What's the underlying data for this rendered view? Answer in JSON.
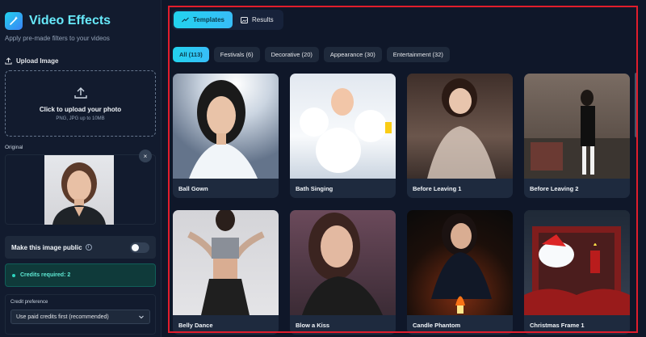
{
  "brand": {
    "title": "Video Effects",
    "subtitle": "Apply pre-made filters to your videos"
  },
  "upload": {
    "label": "Upload Image",
    "drop_title": "Click to upload your photo",
    "drop_sub": "PNG, JPG up to 10MB"
  },
  "original": {
    "label": "Original",
    "close_glyph": "×"
  },
  "public_toggle": {
    "label": "Make this image public",
    "on": false
  },
  "credits": {
    "text": "Credits required: 2"
  },
  "preference": {
    "label": "Credit preference",
    "selected": "Use paid credits first (recommended)"
  },
  "tabs": [
    {
      "label": "Templates",
      "active": true,
      "icon": "trend-icon"
    },
    {
      "label": "Results",
      "active": false,
      "icon": "image-icon"
    }
  ],
  "filters": [
    {
      "label": "All (113)",
      "active": true
    },
    {
      "label": "Festivals (6)",
      "active": false
    },
    {
      "label": "Decorative (20)",
      "active": false
    },
    {
      "label": "Appearance (30)",
      "active": false
    },
    {
      "label": "Entertainment (32)",
      "active": false
    }
  ],
  "templates": [
    {
      "title": "Ball Gown"
    },
    {
      "title": "Bath Singing"
    },
    {
      "title": "Before Leaving 1"
    },
    {
      "title": "Before Leaving 2"
    },
    {
      "title": "Belly Dance"
    },
    {
      "title": "Blow a Kiss"
    },
    {
      "title": "Candle Phantom"
    },
    {
      "title": "Christmas Frame 1"
    }
  ],
  "colors": {
    "accent": "#22d3ee",
    "frame": "#e11d2c",
    "background": "#0f1729"
  }
}
